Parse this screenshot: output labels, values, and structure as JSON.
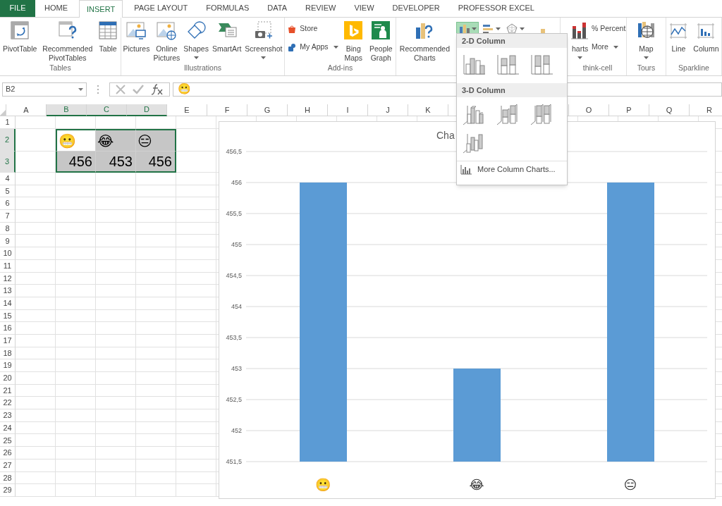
{
  "tabs": [
    {
      "label": "FILE",
      "kind": "file",
      "selected": false
    },
    {
      "label": "HOME",
      "kind": "tab",
      "selected": false
    },
    {
      "label": "INSERT",
      "kind": "tab",
      "selected": true
    },
    {
      "label": "PAGE LAYOUT",
      "kind": "tab",
      "selected": false
    },
    {
      "label": "FORMULAS",
      "kind": "tab",
      "selected": false
    },
    {
      "label": "DATA",
      "kind": "tab",
      "selected": false
    },
    {
      "label": "REVIEW",
      "kind": "tab",
      "selected": false
    },
    {
      "label": "VIEW",
      "kind": "tab",
      "selected": false
    },
    {
      "label": "DEVELOPER",
      "kind": "tab",
      "selected": false
    },
    {
      "label": "PROFESSOR EXCEL",
      "kind": "tab",
      "selected": false
    }
  ],
  "ribbon": [
    {
      "label": "Tables",
      "items": [
        {
          "kind": "large",
          "label": "PivotTable"
        },
        {
          "kind": "large",
          "label": "Recommended PivotTables"
        },
        {
          "kind": "large",
          "label": "Table"
        }
      ]
    },
    {
      "label": "Illustrations",
      "items": [
        {
          "kind": "large",
          "label": "Pictures"
        },
        {
          "kind": "large",
          "label": "Online Pictures"
        },
        {
          "kind": "large",
          "label": "Shapes",
          "dropdown": true
        },
        {
          "kind": "large",
          "label": "SmartArt"
        },
        {
          "kind": "large",
          "label": "Screenshot",
          "dropdown": true
        }
      ]
    },
    {
      "label": "Add-ins",
      "items": [
        {
          "kind": "stack",
          "items": [
            {
              "label": "Store"
            },
            {
              "label": "My Apps",
              "dropdown": true
            }
          ]
        },
        {
          "kind": "large",
          "label": "Bing Maps"
        },
        {
          "kind": "large",
          "label": "People Graph"
        }
      ]
    },
    {
      "items": [
        {
          "kind": "large",
          "label": "Recommended Charts"
        },
        {
          "kind": "splits",
          "items": [
            {
              "selected": true
            },
            {
              "selected": false
            },
            {
              "selected": false
            }
          ]
        },
        {
          "kind": "iconbig"
        }
      ]
    },
    {
      "label": "think-cell",
      "items": [
        {
          "kind": "large",
          "label": "harts",
          "dropdown": true
        },
        {
          "kind": "stack",
          "items": [
            {
              "label": "% Percent"
            },
            {
              "label": "More",
              "dropdown": true
            }
          ]
        }
      ]
    },
    {
      "label": "Tours",
      "items": [
        {
          "kind": "large",
          "label": "Map",
          "dropdown": true
        }
      ]
    },
    {
      "label": "Sparkline",
      "items": [
        {
          "kind": "large",
          "label": "Line"
        },
        {
          "kind": "large",
          "label": "Column"
        }
      ]
    }
  ],
  "name_box": "B2",
  "formula": "😬",
  "sheet": {
    "columns": [
      {
        "kind": "header",
        "label": "A",
        "selected": false
      },
      {
        "kind": "header",
        "label": "B",
        "selected": true
      },
      {
        "kind": "header",
        "label": "C",
        "selected": true
      },
      {
        "kind": "header",
        "label": "D",
        "selected": true
      },
      {
        "kind": "header",
        "label": "E",
        "selected": false
      },
      {
        "kind": "header",
        "label": "F",
        "selected": false
      },
      {
        "kind": "header",
        "label": "G",
        "selected": false
      },
      {
        "kind": "header",
        "label": "H",
        "selected": false
      },
      {
        "kind": "header",
        "label": "I",
        "selected": false
      },
      {
        "kind": "header",
        "label": "J",
        "selected": false
      },
      {
        "kind": "header",
        "label": "K",
        "selected": false
      },
      {
        "kind": "covered"
      },
      {
        "kind": "covered"
      },
      {
        "kind": "covered"
      },
      {
        "kind": "header",
        "label": "O",
        "selected": false
      },
      {
        "kind": "header",
        "label": "P",
        "selected": false
      },
      {
        "kind": "header",
        "label": "Q",
        "selected": false
      },
      {
        "kind": "header",
        "label": "R",
        "selected": false
      }
    ],
    "rows": [
      {
        "label": "1",
        "selected": false
      },
      {
        "label": "2",
        "selected": true,
        "cells": [
          {
            "value": "😬",
            "kind": "emoji",
            "active": true
          },
          {
            "value": "😂",
            "kind": "emoji",
            "active": false
          },
          {
            "value": "😑",
            "kind": "emoji",
            "active": false
          }
        ]
      },
      {
        "label": "3",
        "selected": true,
        "cells": [
          {
            "value": "456",
            "kind": "number",
            "active": false
          },
          {
            "value": "453",
            "kind": "number",
            "active": false
          },
          {
            "value": "456",
            "kind": "number",
            "active": false
          }
        ]
      },
      {
        "label": "4",
        "selected": false
      },
      {
        "label": "5",
        "selected": false
      },
      {
        "label": "6",
        "selected": false
      },
      {
        "label": "7",
        "selected": false
      },
      {
        "label": "8",
        "selected": false
      },
      {
        "label": "9",
        "selected": false
      },
      {
        "label": "10",
        "selected": false
      },
      {
        "label": "11",
        "selected": false
      },
      {
        "label": "12",
        "selected": false
      },
      {
        "label": "13",
        "selected": false
      },
      {
        "label": "14",
        "selected": false
      },
      {
        "label": "15",
        "selected": false
      },
      {
        "label": "16",
        "selected": false
      },
      {
        "label": "17",
        "selected": false
      },
      {
        "label": "18",
        "selected": false
      },
      {
        "label": "19",
        "selected": false
      },
      {
        "label": "20",
        "selected": false
      },
      {
        "label": "21",
        "selected": false
      },
      {
        "label": "22",
        "selected": false
      },
      {
        "label": "23",
        "selected": false
      },
      {
        "label": "24",
        "selected": false
      },
      {
        "label": "25",
        "selected": false
      },
      {
        "label": "26",
        "selected": false
      },
      {
        "label": "27",
        "selected": false
      },
      {
        "label": "28",
        "selected": false
      },
      {
        "label": "29",
        "selected": false
      }
    ]
  },
  "chart": {
    "chart_data": {
      "type": "bar",
      "title": "Cha",
      "grid": true,
      "categories": [
        "😬",
        "😂",
        "😑"
      ],
      "values": [
        456,
        453,
        456
      ],
      "ylim": [
        451.5,
        456.5
      ],
      "yticks": [
        {
          "value": 451.5,
          "label": "451,5"
        },
        {
          "value": 452,
          "label": "452"
        },
        {
          "value": 452.5,
          "label": "452,5"
        },
        {
          "value": 453,
          "label": "453"
        },
        {
          "value": 453.5,
          "label": "453,5"
        },
        {
          "value": 454,
          "label": "454"
        },
        {
          "value": 454.5,
          "label": "454,5"
        },
        {
          "value": 455,
          "label": "455"
        },
        {
          "value": 455.5,
          "label": "455,5"
        },
        {
          "value": 456,
          "label": "456"
        },
        {
          "value": 456.5,
          "label": "456,5"
        }
      ]
    }
  },
  "dropdown": {
    "sections": [
      {
        "title": "2-D Column",
        "kind": "flat"
      },
      {
        "title": "3-D Column",
        "kind": "perspective"
      }
    ],
    "footer": "More Column Charts..."
  }
}
